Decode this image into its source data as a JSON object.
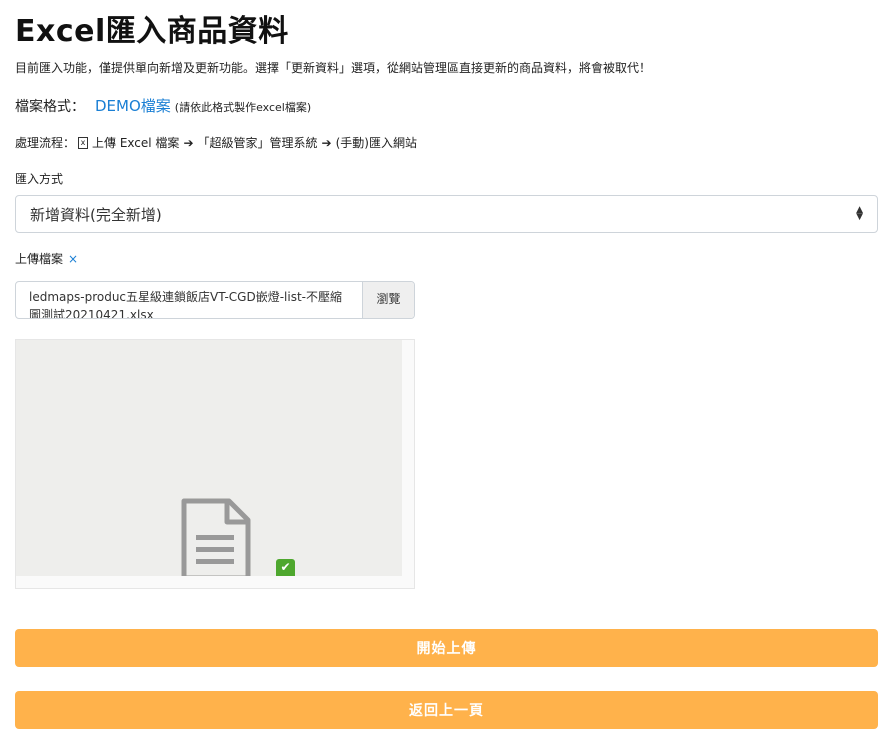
{
  "page": {
    "title": "Excel匯入商品資料",
    "description": "目前匯入功能，僅提供單向新增及更新功能。選擇「更新資料」選項，從網站管理區直接更新的商品資料，將會被取代！"
  },
  "format": {
    "label": "檔案格式：",
    "demo_link": "DEMO檔案",
    "note": "(請依此格式製作excel檔案)"
  },
  "flow": {
    "prefix": "處理流程：",
    "step1": "上傳 Excel 檔案",
    "step2": "「超級管家」管理系統",
    "step3": "(手動)匯入網站"
  },
  "import_method": {
    "label": "匯入方式",
    "selected": "新增資料(完全新增)"
  },
  "upload": {
    "label": "上傳檔案",
    "clear": "×",
    "file_name": "ledmaps-produc五星級連鎖飯店VT-CGD嵌燈-list-不壓縮圖測試20210421.xlsx",
    "browse_label": "瀏覽"
  },
  "buttons": {
    "start_upload": "開始上傳",
    "back": "返回上一頁"
  },
  "icons": {
    "file_icon": "file-excel-icon",
    "arrow": "arrow-right-icon",
    "document": "document-icon",
    "check": "check-icon",
    "caret": "select-caret-icon"
  },
  "colors": {
    "accent": "#1a7fd4",
    "button": "#ffb24b",
    "success": "#4ea72e"
  }
}
